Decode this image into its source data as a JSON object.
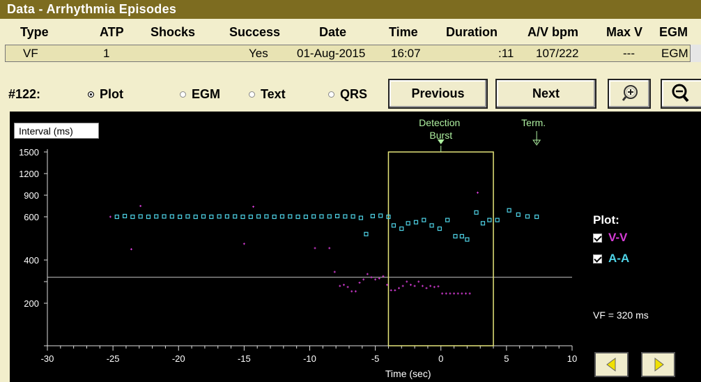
{
  "window": {
    "title": "Data - Arrhythmia Episodes"
  },
  "table": {
    "headers": [
      "Type",
      "ATP",
      "Shocks",
      "Success",
      "Date",
      "Time",
      "Duration",
      "A/V bpm",
      "Max V",
      "EGM"
    ],
    "row": {
      "type": "VF",
      "atp": "1",
      "shocks": "",
      "success": "Yes",
      "date": "01-Aug-2015",
      "time": "16:07",
      "duration": ":11",
      "av_bpm": "107/222",
      "max_v": "---",
      "egm": "EGM"
    }
  },
  "controls": {
    "episode": "#122:",
    "view_options": [
      {
        "label": "Plot",
        "selected": true
      },
      {
        "label": "EGM",
        "selected": false
      },
      {
        "label": "Text",
        "selected": false
      },
      {
        "label": "QRS",
        "selected": false
      }
    ],
    "previous_label": "Previous",
    "next_label": "Next",
    "zoom_in_icon": "zoom-in-icon",
    "zoom_out_icon": "zoom-out-icon"
  },
  "legend": {
    "title": "Plot:",
    "items": [
      {
        "label": "V-V",
        "checked": true,
        "color": "#d63cd6"
      },
      {
        "label": "A-A",
        "checked": true,
        "color": "#4fd4e8"
      }
    ],
    "vf_text": "VF = 320 ms"
  },
  "nav": {
    "prev_icon": "triangle-left-icon",
    "next_icon": "triangle-right-icon"
  },
  "colors": {
    "title_bar": "#7d6c20",
    "panel": "#f2eecc",
    "row_highlight": "#e8e3b3",
    "box": "#e6e67a",
    "markers": "#aef0a0"
  },
  "chart_data": {
    "type": "scatter",
    "ylabel": "Interval (ms)",
    "xlabel": "Time (sec)",
    "xlim": [
      -30,
      10
    ],
    "x_ticks": [
      -30,
      -25,
      -20,
      -15,
      -10,
      -5,
      0,
      5,
      10
    ],
    "y_ticks": [
      1500,
      1200,
      900,
      600,
      400,
      200
    ],
    "vf_threshold_ms": 320,
    "highlight_window": [
      -4,
      4
    ],
    "annotations": [
      {
        "text": "Detection",
        "x": 0
      },
      {
        "text": "Burst",
        "x": 0
      },
      {
        "text": "Term.",
        "x": 7.3
      }
    ],
    "series": [
      {
        "name": "V-V",
        "marker": "dot",
        "points": [
          [
            -25.2,
            600
          ],
          [
            -23.6,
            450
          ],
          [
            -22.9,
            750
          ],
          [
            -15,
            475
          ],
          [
            -14.3,
            740
          ],
          [
            -9.6,
            455
          ],
          [
            -8.5,
            455
          ],
          [
            -8.1,
            345
          ],
          [
            -7.7,
            280
          ],
          [
            -7.4,
            285
          ],
          [
            -7.1,
            275
          ],
          [
            -6.8,
            255
          ],
          [
            -6.5,
            255
          ],
          [
            -6.2,
            295
          ],
          [
            -5.9,
            310
          ],
          [
            -5.6,
            335
          ],
          [
            -5.3,
            320
          ],
          [
            -5.0,
            310
          ],
          [
            -4.7,
            315
          ],
          [
            -4.4,
            325
          ],
          [
            -4.1,
            285
          ],
          [
            -3.8,
            260
          ],
          [
            -3.5,
            260
          ],
          [
            -3.2,
            270
          ],
          [
            -2.9,
            280
          ],
          [
            -2.6,
            300
          ],
          [
            -2.3,
            285
          ],
          [
            -2.0,
            280
          ],
          [
            -1.7,
            300
          ],
          [
            -1.4,
            280
          ],
          [
            -1.1,
            270
          ],
          [
            -0.8,
            280
          ],
          [
            -0.5,
            275
          ],
          [
            -0.2,
            278
          ],
          [
            0.1,
            245
          ],
          [
            0.4,
            245
          ],
          [
            0.7,
            245
          ],
          [
            1.0,
            245
          ],
          [
            1.3,
            245
          ],
          [
            1.6,
            245
          ],
          [
            1.9,
            245
          ],
          [
            2.2,
            245
          ],
          [
            2.8,
            935
          ]
        ]
      },
      {
        "name": "A-A",
        "marker": "square",
        "points": [
          [
            -24.7,
            600
          ],
          [
            -24.1,
            610
          ],
          [
            -23.5,
            600
          ],
          [
            -22.9,
            605
          ],
          [
            -22.3,
            600
          ],
          [
            -21.7,
            605
          ],
          [
            -21.1,
            605
          ],
          [
            -20.5,
            605
          ],
          [
            -19.9,
            600
          ],
          [
            -19.3,
            605
          ],
          [
            -18.7,
            600
          ],
          [
            -18.1,
            605
          ],
          [
            -17.5,
            600
          ],
          [
            -16.9,
            605
          ],
          [
            -16.3,
            605
          ],
          [
            -15.7,
            605
          ],
          [
            -15.1,
            600
          ],
          [
            -14.5,
            600
          ],
          [
            -13.9,
            605
          ],
          [
            -13.3,
            605
          ],
          [
            -12.7,
            600
          ],
          [
            -12.1,
            605
          ],
          [
            -11.5,
            605
          ],
          [
            -10.9,
            600
          ],
          [
            -10.3,
            600
          ],
          [
            -9.7,
            605
          ],
          [
            -9.1,
            605
          ],
          [
            -8.5,
            605
          ],
          [
            -7.9,
            610
          ],
          [
            -7.3,
            605
          ],
          [
            -6.7,
            605
          ],
          [
            -6.1,
            595
          ],
          [
            -5.7,
            520
          ],
          [
            -5.2,
            610
          ],
          [
            -4.6,
            615
          ],
          [
            -4.0,
            600
          ],
          [
            -3.6,
            560
          ],
          [
            -3.0,
            545
          ],
          [
            -2.5,
            570
          ],
          [
            -1.9,
            575
          ],
          [
            -1.3,
            585
          ],
          [
            -0.7,
            560
          ],
          [
            -0.1,
            545
          ],
          [
            0.5,
            585
          ],
          [
            1.1,
            510
          ],
          [
            1.6,
            510
          ],
          [
            2.0,
            495
          ],
          [
            2.7,
            660
          ],
          [
            3.2,
            570
          ],
          [
            3.7,
            585
          ],
          [
            4.3,
            585
          ],
          [
            5.2,
            690
          ],
          [
            5.9,
            630
          ],
          [
            6.6,
            605
          ],
          [
            7.3,
            600
          ]
        ]
      }
    ]
  }
}
